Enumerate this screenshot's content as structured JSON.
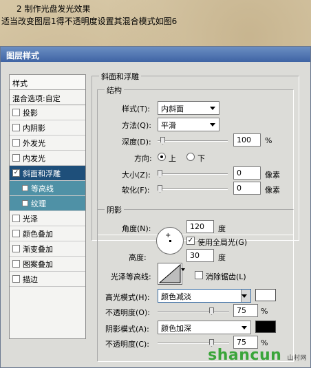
{
  "tutorial": {
    "line1": "2  制作光盘发光效果",
    "line2": "适当改变图层1得不透明度设置其混合模式如图6"
  },
  "dialog": {
    "title": "图层样式"
  },
  "sidebar": {
    "header": "样式",
    "blend_options": "混合选项:自定",
    "items": [
      {
        "label": "投影",
        "checked": false
      },
      {
        "label": "内阴影",
        "checked": false
      },
      {
        "label": "外发光",
        "checked": false
      },
      {
        "label": "内发光",
        "checked": false
      },
      {
        "label": "斜面和浮雕",
        "checked": true
      },
      {
        "label": "等高线",
        "checked": false
      },
      {
        "label": "纹理",
        "checked": false
      },
      {
        "label": "光泽",
        "checked": false
      },
      {
        "label": "颜色叠加",
        "checked": false
      },
      {
        "label": "渐变叠加",
        "checked": false
      },
      {
        "label": "图案叠加",
        "checked": false
      },
      {
        "label": "描边",
        "checked": false
      }
    ]
  },
  "bevel": {
    "title": "斜面和浮雕",
    "structure": {
      "title": "结构",
      "style_label": "样式(T):",
      "style_value": "内斜面",
      "technique_label": "方法(Q):",
      "technique_value": "平滑",
      "depth_label": "深度(D):",
      "depth_value": "100",
      "depth_unit": "%",
      "direction_label": "方向:",
      "direction_up": "上",
      "direction_down": "下",
      "size_label": "大小(Z):",
      "size_value": "0",
      "size_unit": "像素",
      "soften_label": "软化(F):",
      "soften_value": "0",
      "soften_unit": "像素"
    },
    "shading": {
      "title": "阴影",
      "angle_label": "角度(N):",
      "angle_value": "120",
      "angle_unit": "度",
      "global_light_label": "使用全局光(G)",
      "altitude_label": "高度:",
      "altitude_value": "30",
      "altitude_unit": "度",
      "gloss_contour_label": "光泽等高线:",
      "anti_aliased_label": "消除锯齿(L)",
      "highlight_mode_label": "高光模式(H):",
      "highlight_mode_value": "颜色减淡",
      "highlight_color": "#ffffff",
      "highlight_opacity_label": "不透明度(O):",
      "highlight_opacity_value": "75",
      "highlight_opacity_unit": "%",
      "shadow_mode_label": "阴影模式(A):",
      "shadow_mode_value": "颜色加深",
      "shadow_color": "#000000",
      "shadow_opacity_label": "不透明度(C):",
      "shadow_opacity_value": "75",
      "shadow_opacity_unit": "%"
    }
  },
  "watermark": {
    "text": "shancun",
    "suffix": "山村网"
  }
}
